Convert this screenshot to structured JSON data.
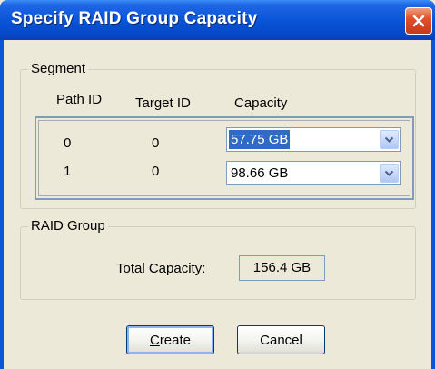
{
  "window": {
    "title": "Specify RAID Group Capacity"
  },
  "segment": {
    "legend": "Segment",
    "columns": {
      "path_id": "Path ID",
      "target_id": "Target ID",
      "capacity": "Capacity"
    },
    "rows": [
      {
        "path_id": "0",
        "target_id": "0",
        "capacity": "57.75 GB",
        "selected": true
      },
      {
        "path_id": "1",
        "target_id": "0",
        "capacity": "98.66 GB",
        "selected": false
      }
    ]
  },
  "raid_group": {
    "legend": "RAID Group",
    "total_capacity_label": "Total Capacity:",
    "total_capacity_value": "156.4 GB"
  },
  "buttons": {
    "create_mnemonic": "C",
    "create_rest": "reate",
    "cancel": "Cancel"
  },
  "colors": {
    "titlebar": "#0a55d8",
    "selection": "#316ac5",
    "dialog_bg": "#ece9d8",
    "close_button": "#e2502a"
  },
  "icons": {
    "close": "close-icon",
    "dropdown": "chevron-down-icon"
  }
}
